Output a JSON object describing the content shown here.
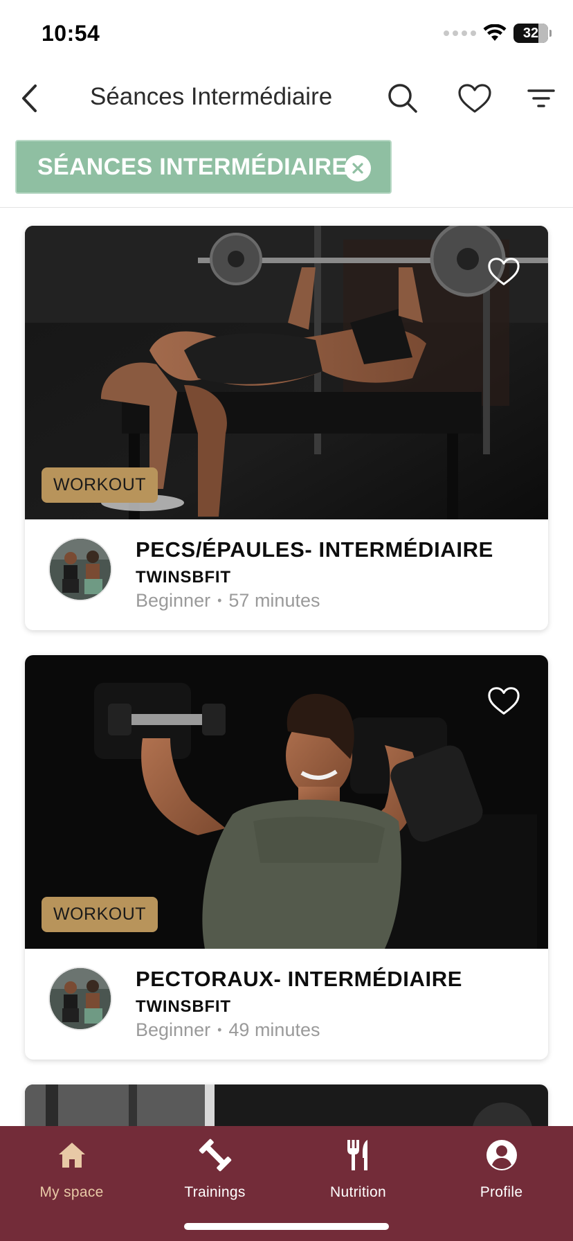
{
  "status_bar": {
    "time": "10:54",
    "battery": "32"
  },
  "nav": {
    "title": "Séances Intermédiaire",
    "back_icon": "chevron-left-icon",
    "search_icon": "search-icon",
    "favorites_icon": "heart-icon",
    "filter_icon": "filter-icon"
  },
  "filter_chip": {
    "label": "SÉANCES INTERMÉDIAIRE",
    "close_icon": "close-circle-icon",
    "color": "#8fbfa2"
  },
  "cards": [
    {
      "badge": "WORKOUT",
      "title": "PECS/ÉPAULES- INTERMÉDIAIRE",
      "author": "TWINSBFIT",
      "level": "Beginner",
      "separator": "•",
      "duration": "57 minutes"
    },
    {
      "badge": "WORKOUT",
      "title": "PECTORAUX- INTERMÉDIAIRE",
      "author": "TWINSBFIT",
      "level": "Beginner",
      "separator": "•",
      "duration": "49 minutes"
    }
  ],
  "tab_bar": {
    "background": "#732c39",
    "active_color": "#e8c9a6",
    "tabs": [
      {
        "label": "My space",
        "icon": "home-icon",
        "active": true
      },
      {
        "label": "Trainings",
        "icon": "dumbbell-icon",
        "active": false
      },
      {
        "label": "Nutrition",
        "icon": "fork-knife-icon",
        "active": false
      },
      {
        "label": "Profile",
        "icon": "profile-icon",
        "active": false
      }
    ]
  }
}
